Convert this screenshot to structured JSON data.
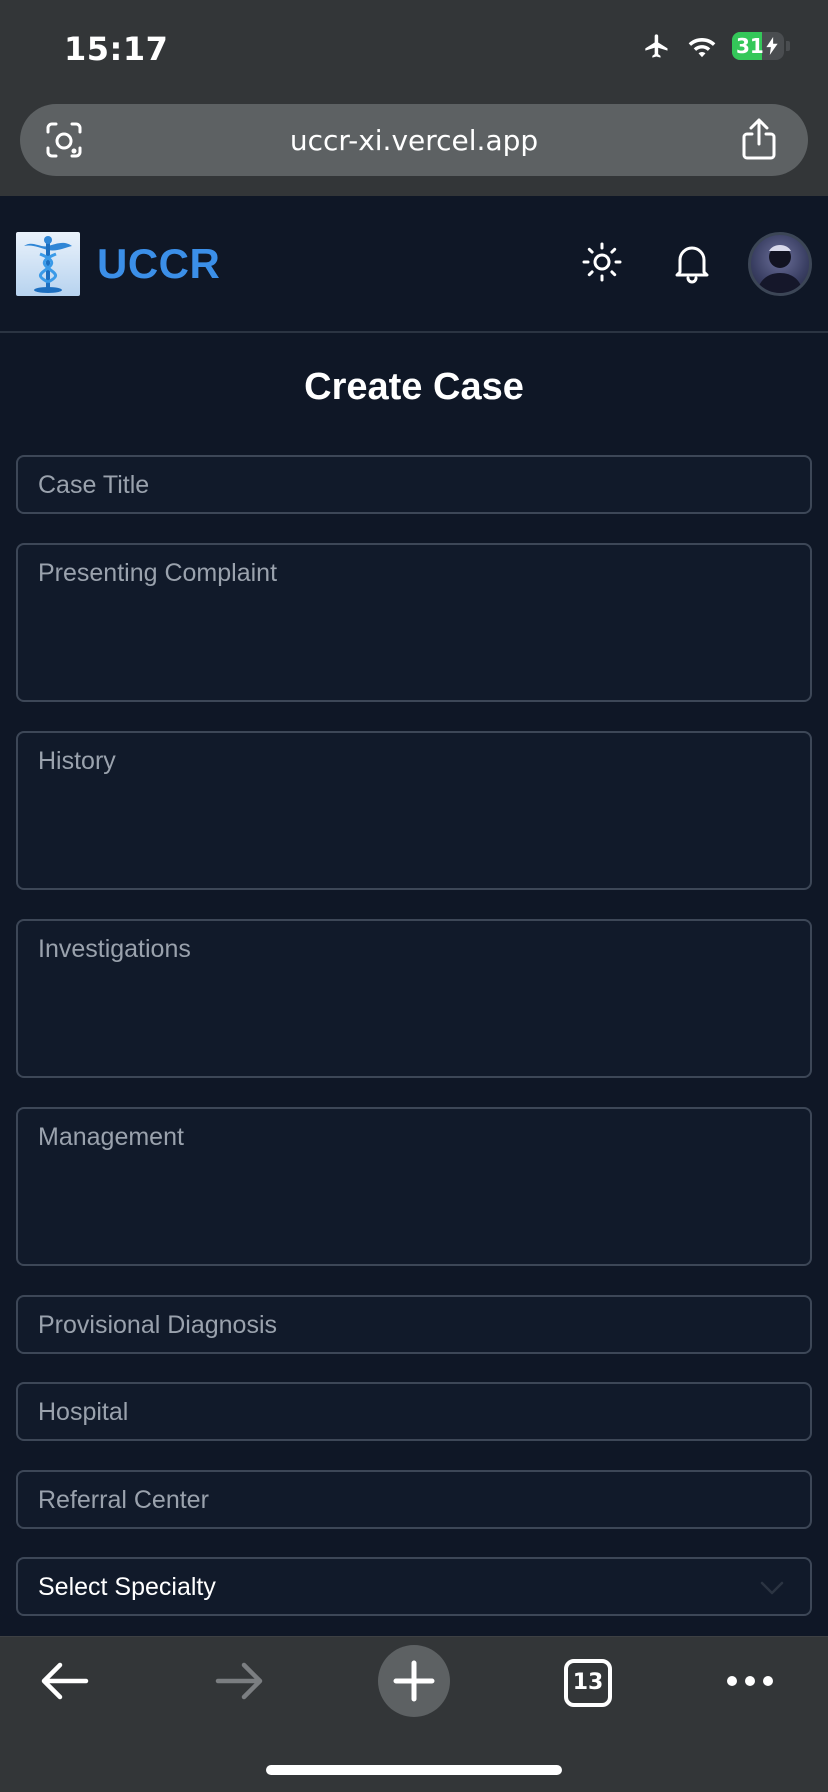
{
  "status_bar": {
    "time": "15:17",
    "battery": "31"
  },
  "browser": {
    "url": "uccr-xi.vercel.app",
    "tab_count": "13"
  },
  "header": {
    "brand": "UCCR"
  },
  "form": {
    "title": "Create Case",
    "case_title_placeholder": "Case Title",
    "presenting_complaint_placeholder": "Presenting Complaint",
    "history_placeholder": "History",
    "investigations_placeholder": "Investigations",
    "management_placeholder": "Management",
    "provisional_diagnosis_placeholder": "Provisional Diagnosis",
    "hospital_placeholder": "Hospital",
    "referral_center_placeholder": "Referral Center",
    "specialty_select": "Select Specialty"
  },
  "colors": {
    "brand": "#3b8fe8",
    "background": "#0f1726",
    "battery": "#34c759"
  }
}
